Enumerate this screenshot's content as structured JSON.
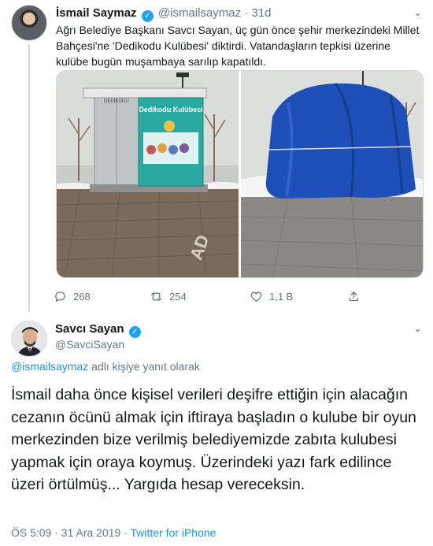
{
  "tweet1": {
    "author_name": "İsmail Saymaz",
    "author_handle": "@ismailsaymaz",
    "separator": "·",
    "time_ago": "31d",
    "text": "Ağrı Belediye Başkanı Savcı Sayan, üç gün önce şehir merkezindeki Millet Bahçesi'ne 'Dedikodu Kulübesi' diktirdi. Vatandaşların tepkisi üzerine kulübe bugün muşambaya sarılıp kapatıldı.",
    "media_left_sign": "Dedikodu Kulübesi",
    "media_left_header": "DEDİKODU",
    "media_left_road": "AD",
    "actions": {
      "replies": "268",
      "retweets": "254",
      "likes": "1,1 B"
    }
  },
  "tweet2": {
    "author_name": "Savcı Sayan",
    "author_handle": "@SavciSayan",
    "reply_mention": "@ismailsaymaz",
    "reply_suffix": " adlı kişiye yanıt olarak",
    "text": "İsmail daha önce kişisel verileri deşifre ettiğin için alacağın cezanın öcünü almak için iftiraya başladın o kulube bir oyun merkezinden bize verilmiş belediyemizde zabıta kulubesi yapmak için oraya koymuş. Üzerindeki yazı fark edilince üzeri örtülmüş... Yargıda hesap vereceksin.",
    "timestamp": "ÖS 5:09 · 31 Ara 2019 · ",
    "source": "Twitter for iPhone"
  },
  "colors": {
    "accent": "#1da1f2",
    "link": "#1b95e0",
    "secondary_text": "#657786",
    "tarp_blue": "#1e4fb8",
    "kiosk_teal": "#2aa9a0"
  },
  "icons": {
    "verified": "verified-badge-icon",
    "more": "chevron-down-icon",
    "reply": "reply-icon",
    "retweet": "retweet-icon",
    "like": "heart-icon",
    "share": "share-icon"
  }
}
